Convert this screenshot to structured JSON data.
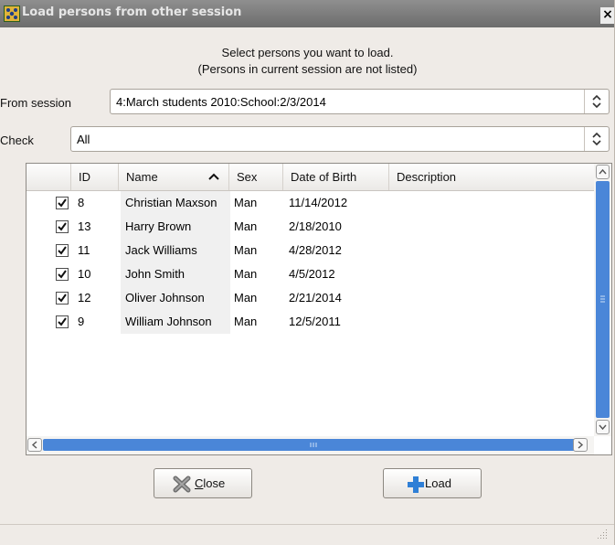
{
  "window": {
    "title": "Load persons from other session",
    "close_label": "×"
  },
  "instructions": {
    "line1": "Select persons you want to load.",
    "line2": "(Persons in current session are not listed)"
  },
  "from_session": {
    "label": "From session",
    "value": "4:March students 2010:School:2/3/2014"
  },
  "check": {
    "label": "Check",
    "value": "All"
  },
  "table": {
    "columns": [
      "ID",
      "Name",
      "Sex",
      "Date of Birth",
      "Description"
    ],
    "sort_column": "Name",
    "rows": [
      {
        "checked": true,
        "id": "8",
        "name": "Christian Maxson",
        "sex": "Man",
        "dob": "11/14/2012",
        "description": ""
      },
      {
        "checked": true,
        "id": "13",
        "name": "Harry Brown",
        "sex": "Man",
        "dob": "2/18/2010",
        "description": ""
      },
      {
        "checked": true,
        "id": "11",
        "name": "Jack Williams",
        "sex": "Man",
        "dob": "4/28/2012",
        "description": ""
      },
      {
        "checked": true,
        "id": "10",
        "name": "John Smith",
        "sex": "Man",
        "dob": "4/5/2012",
        "description": ""
      },
      {
        "checked": true,
        "id": "12",
        "name": "Oliver Johnson",
        "sex": "Man",
        "dob": "2/21/2014",
        "description": ""
      },
      {
        "checked": true,
        "id": "9",
        "name": "William Johnson",
        "sex": "Man",
        "dob": "12/5/2011",
        "description": ""
      }
    ]
  },
  "buttons": {
    "close_label": "Close",
    "close_mnemonic": "C",
    "close_rest": "lose",
    "load_label": "Load"
  },
  "icons": {
    "app": "app-grid-icon",
    "close": "x-icon",
    "load": "plus-icon",
    "combo_arrow": "up-down-arrows-icon",
    "sort": "sort-ascending-icon"
  },
  "colors": {
    "titlebar": "#7d7d7d",
    "scroll_thumb": "#4a86d8",
    "load_plus": "#2f7fd6"
  }
}
